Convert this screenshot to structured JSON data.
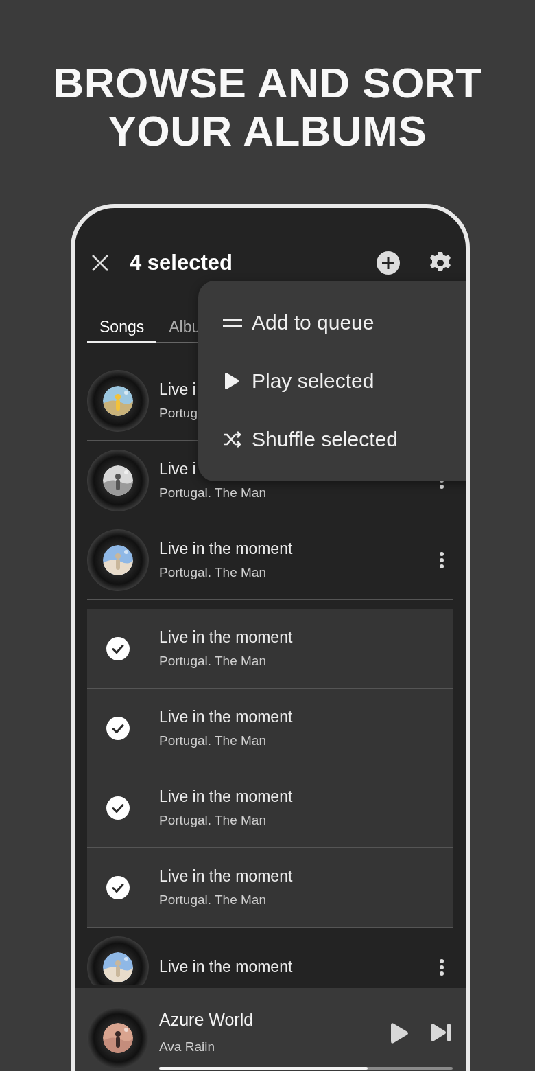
{
  "headline": [
    "BROWSE AND SORT",
    "YOUR ALBUMS"
  ],
  "toolbar": {
    "title": "4 selected"
  },
  "tabs": [
    {
      "label": "Songs",
      "selected": true
    },
    {
      "label": "Albu",
      "selected": false
    }
  ],
  "songs": [
    {
      "title": "Live i",
      "artist": "Portug",
      "selected": false
    },
    {
      "title": "Live i",
      "artist": "Portugal. The Man",
      "selected": false
    },
    {
      "title": "Live in the moment",
      "artist": "Portugal. The Man",
      "selected": false
    },
    {
      "title": "Live in the moment",
      "artist": "Portugal. The Man",
      "selected": true
    },
    {
      "title": "Live in the moment",
      "artist": "Portugal. The Man",
      "selected": true
    },
    {
      "title": "Live in the moment",
      "artist": "Portugal. The Man",
      "selected": true
    },
    {
      "title": "Live in the moment",
      "artist": "Portugal. The Man",
      "selected": true
    },
    {
      "title": "Live in the moment",
      "selected": false
    }
  ],
  "menu": [
    {
      "kind": "queue",
      "label": "Add to queue"
    },
    {
      "kind": "play",
      "label": "Play selected"
    },
    {
      "kind": "shuffle",
      "label": "Shuffle selected"
    }
  ],
  "now_playing": {
    "title": "Azure World",
    "artist": "Ava Raiin",
    "level": 0.71
  }
}
